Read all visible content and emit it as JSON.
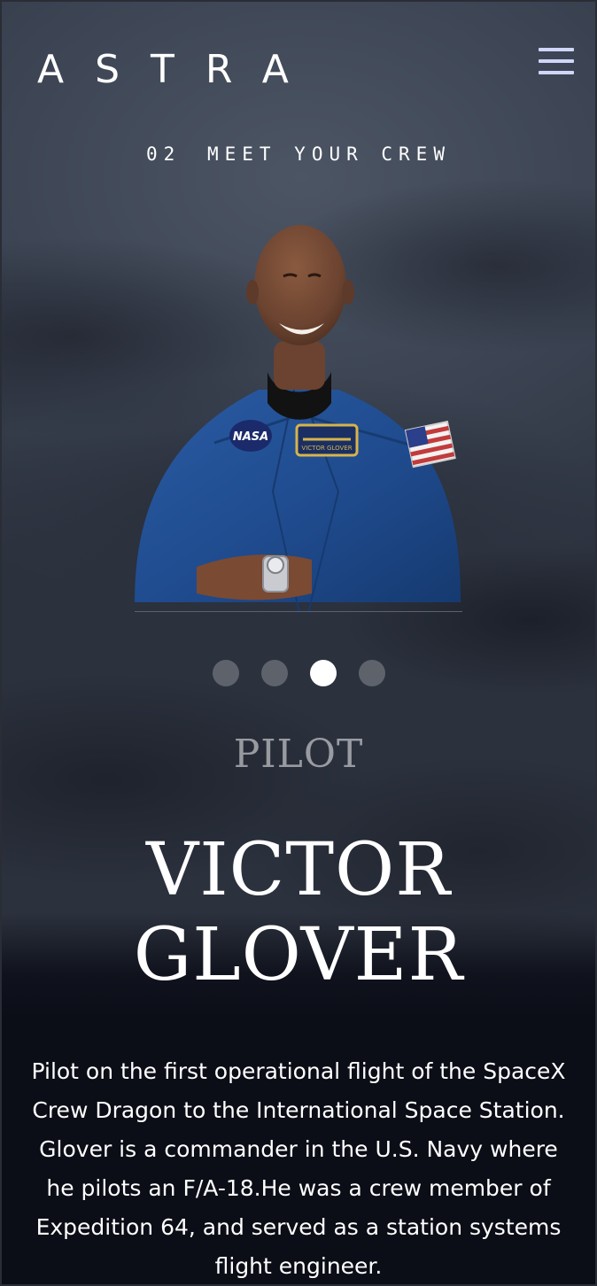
{
  "brand": {
    "logo": "ASTRA"
  },
  "nav": {
    "menu_icon": "hamburger-menu-icon"
  },
  "page": {
    "number": "02",
    "title": "MEET YOUR CREW"
  },
  "crew": {
    "role": "PILOT",
    "name_line1": "VICTOR",
    "name_line2": "GLOVER",
    "bio": "Pilot on the first operational flight of the SpaceX Crew Dragon to the International Space Station. Glover is a commander in the U.S. Navy where he pilots an F/A-18.He was a crew member of Expedition 64, and served as a station systems flight engineer.",
    "photo_alt": "Portrait of Victor Glover in a blue flight suit",
    "nametag_text": "VICTOR GLOVER",
    "nasa_patch_text": "NASA"
  },
  "carousel": {
    "total": 4,
    "active_index": 2
  },
  "colors": {
    "background": "#0b0d17",
    "accent": "#d0d6f9",
    "flight_suit": "#1f4b8e"
  }
}
